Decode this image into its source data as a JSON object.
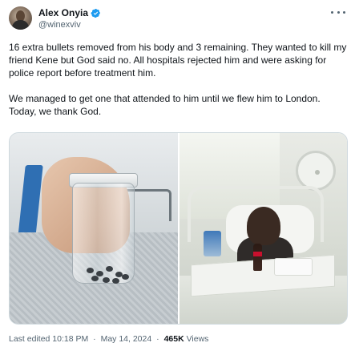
{
  "author": {
    "name": "Alex Onyia",
    "handle": "@winexviv",
    "verified_color": "#1d9bf0",
    "avatar_icon": "avatar-photo"
  },
  "more_icon": "more-horizontal-icon",
  "tweet": {
    "paragraphs": [
      "16 extra bullets removed from his body and 3 remaining. They wanted to kill my friend Kene but God said no. All hospitals rejected him and were asking for police report before treatment him.",
      "We managed to get one that attended to him until we flew him to London. Today, we thank God."
    ]
  },
  "media": {
    "photos": [
      {
        "subject": "jar-of-bullets"
      },
      {
        "subject": "hospital-bed"
      }
    ]
  },
  "footer": {
    "edited": "Last edited 10:18 PM",
    "separator": "·",
    "date": "May 14, 2024",
    "views_count": "465K",
    "views_label": " Views"
  },
  "colors": {
    "text_primary": "#0f1419",
    "text_secondary": "#536471",
    "border": "#cfd9de",
    "accent": "#1d9bf0"
  }
}
